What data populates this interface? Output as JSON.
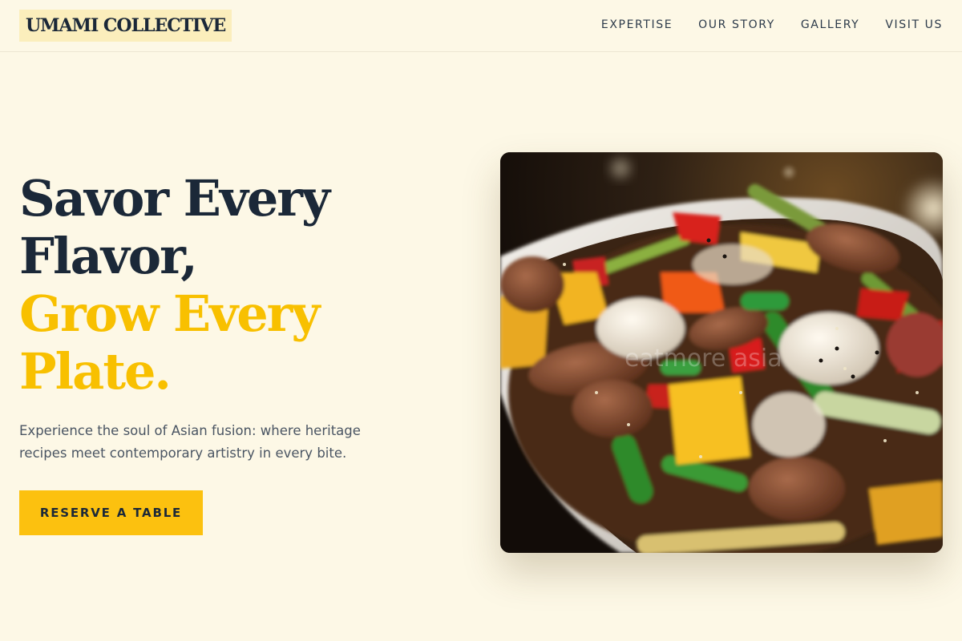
{
  "header": {
    "logo": "UMAMI COLLECTIVE",
    "nav": [
      "EXPERTISE",
      "OUR STORY",
      "GALLERY",
      "VISIT US"
    ]
  },
  "hero": {
    "headline_line1": "Savor Every",
    "headline_line2": "Flavor,",
    "headline_line3": "Grow Every",
    "headline_line4": "Plate.",
    "subtext": "Experience the soul of Asian fusion: where heritage recipes meet contemporary artistry in every bite.",
    "cta_label": "RESERVE A TABLE",
    "image_watermark": "eatmore asia"
  },
  "colors": {
    "background": "#fdf8e6",
    "headline_dark": "#1b2838",
    "accent_gold": "#f8c000",
    "button": "#fcc10f",
    "logo_highlight": "#fbeebc"
  }
}
